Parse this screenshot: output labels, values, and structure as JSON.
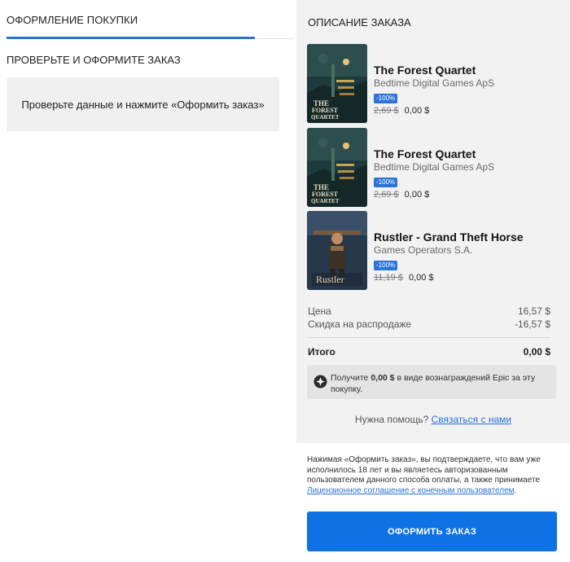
{
  "checkout": {
    "tab_title": "ОФОРМЛЕНИЕ ПОКУПКИ",
    "section_title": "ПРОВЕРЬТЕ И ОФОРМИТЕ ЗАКАЗ",
    "notice": "Проверьте данные и нажмите «Оформить заказ»"
  },
  "summary": {
    "title": "ОПИСАНИЕ ЗАКАЗА",
    "items": [
      {
        "name": "The Forest Quartet",
        "publisher": "Bedtime Digital Games ApS",
        "discount": "-100%",
        "old_price": "2,69 $",
        "new_price": "0,00 $",
        "cover_text": "THE FOREST QUARTET"
      },
      {
        "name": "The Forest Quartet",
        "publisher": "Bedtime Digital Games ApS",
        "discount": "-100%",
        "old_price": "2,69 $",
        "new_price": "0,00 $",
        "cover_text": "THE FOREST QUARTET"
      },
      {
        "name": "Rustler - Grand Theft Horse",
        "publisher": "Games Operators S.A.",
        "discount": "-100%",
        "old_price": "11,19 $",
        "new_price": "0,00 $",
        "cover_text": "Rustler"
      }
    ],
    "price_label": "Цена",
    "price_value": "16,57 $",
    "discount_label": "Скидка на распродаже",
    "discount_value": "-16,57 $",
    "total_label": "Итого",
    "total_value": "0,00 $",
    "reward_prefix": "Получите",
    "reward_amount": "0,00 $",
    "reward_suffix": "в виде вознаграждений Epic за эту покупку.",
    "help_text": "Нужна помощь?",
    "help_link": "Связаться с нами",
    "terms_text": "Нажимая «Оформить заказ», вы подтверждаете, что вам уже исполнилось 18 лет и вы являетесь авторизованным пользователем данного способа оплаты, а также принимаете",
    "terms_link": "Лицензионное соглашение с конечным пользователем",
    "terms_end": ".",
    "order_button": "ОФОРМИТЬ ЗАКАЗ"
  },
  "colors": {
    "accent": "#0e72e4",
    "panel": "#f2f2f2",
    "badge": "#2a73d9"
  }
}
